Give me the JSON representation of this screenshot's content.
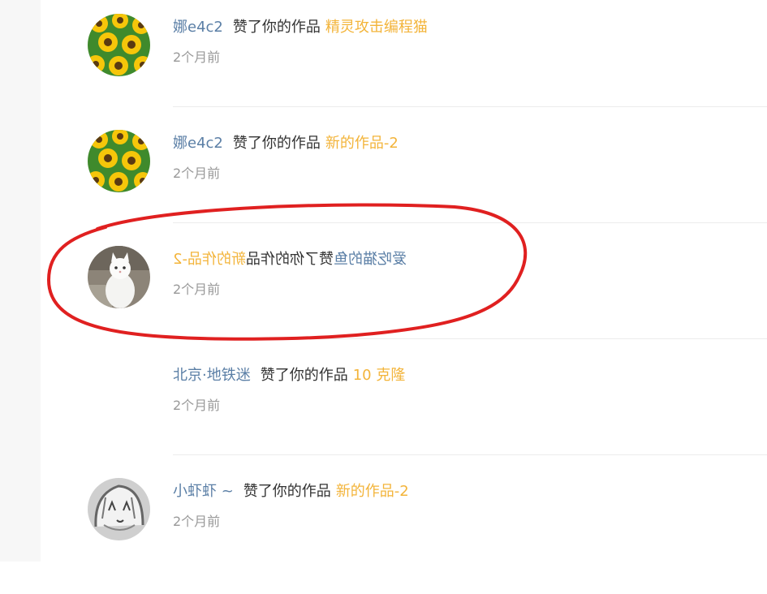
{
  "notifications": [
    {
      "user": "娜e4c2",
      "verb": "赞了你的作品",
      "work": "精灵攻击编程猫",
      "time": "2个月前",
      "avatar_icon": "sunflower-avatar"
    },
    {
      "user": "娜e4c2",
      "verb": "赞了你的作品",
      "work": "新的作品-2",
      "time": "2个月前",
      "avatar_icon": "sunflower-avatar"
    },
    {
      "user": "爱吃猫的鱼",
      "verb": "赞了你的作品",
      "work": "新的作品-2",
      "time": "2个月前",
      "avatar_icon": "white-cat-avatar",
      "rendered_mirrored": true
    },
    {
      "user": "北京·地铁迷",
      "verb": "赞了你的作品",
      "work": "10 克隆",
      "time": "2个月前",
      "avatar_icon": "none"
    },
    {
      "user": "小虾虾 ~",
      "verb": "赞了你的作品",
      "work": "新的作品-2",
      "time": "2个月前",
      "avatar_icon": "sketch-face-avatar"
    }
  ],
  "colors": {
    "user": "#5b7fa6",
    "work": "#f3b43a",
    "verb": "#333333",
    "time": "#999999",
    "annotation": "#e02020"
  }
}
